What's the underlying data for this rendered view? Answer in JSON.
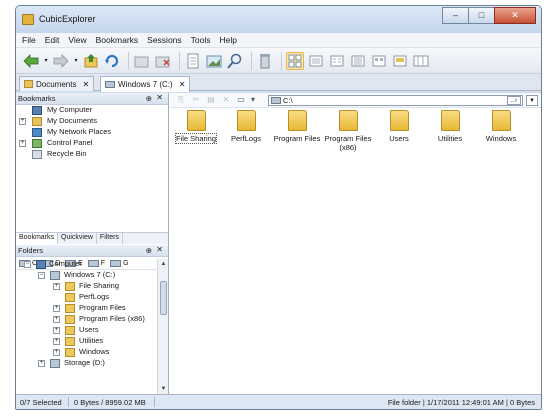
{
  "window": {
    "title": "CubicExplorer",
    "minimize": "–",
    "maximize": "□",
    "close": "✕"
  },
  "menu": [
    "File",
    "Edit",
    "View",
    "Bookmarks",
    "Sessions",
    "Tools",
    "Help"
  ],
  "toolbar_icons": [
    "back-arrow-icon",
    "forward-arrow-icon",
    "up-folder-icon",
    "refresh-icon",
    "new-folder-icon",
    "delete-folder-icon",
    "page-icon",
    "image-icon",
    "search-icon",
    "recycle-icon",
    "thumbnails-view-icon",
    "icons-view-icon",
    "list-view-icon",
    "details-view-icon",
    "tiles-view-icon",
    "filmstrip-view-icon",
    "grid-view-icon"
  ],
  "tabs": [
    {
      "label": "Documents",
      "close": "✕"
    },
    {
      "label": "Windows 7 (C:)",
      "close": "✕"
    }
  ],
  "bookmarks": {
    "title": "Bookmarks",
    "pin": "⊕",
    "close": "✕",
    "items": [
      {
        "label": "My Computer",
        "icon": "computer-icon",
        "expander": ""
      },
      {
        "label": "My Documents",
        "icon": "documents-icon",
        "expander": "+"
      },
      {
        "label": "My Network Places",
        "icon": "network-icon",
        "expander": ""
      },
      {
        "label": "Control Panel",
        "icon": "control-panel-icon",
        "expander": "+"
      },
      {
        "label": "Recycle Bin",
        "icon": "recycle-bin-icon",
        "expander": ""
      }
    ]
  },
  "subtabs": [
    "Bookmarks",
    "Quickview",
    "Filters"
  ],
  "folders": {
    "title": "Folders",
    "pin": "⊕",
    "close": "✕",
    "drives": [
      "C",
      "D",
      "E",
      "F",
      "G"
    ],
    "more": "»",
    "tree": [
      {
        "label": "Computer",
        "expander": "−",
        "icon": "computer-icon"
      },
      {
        "label": "Windows 7 (C:)",
        "expander": "−",
        "icon": "drive-icon"
      },
      {
        "label": "File Sharing",
        "expander": "+",
        "icon": "folder-icon"
      },
      {
        "label": "PerfLogs",
        "expander": "",
        "icon": "folder-icon"
      },
      {
        "label": "Program Files",
        "expander": "+",
        "icon": "folder-icon"
      },
      {
        "label": "Program Files (x86)",
        "expander": "+",
        "icon": "folder-icon"
      },
      {
        "label": "Users",
        "expander": "+",
        "icon": "folder-icon"
      },
      {
        "label": "Utilities",
        "expander": "+",
        "icon": "folder-icon"
      },
      {
        "label": "Windows",
        "expander": "+",
        "icon": "folder-icon"
      },
      {
        "label": "Storage (D:)",
        "expander": "+",
        "icon": "drive-icon"
      }
    ]
  },
  "address": {
    "value": "C:\\",
    "go": "..›"
  },
  "files": [
    {
      "label": "File Sharing",
      "selected": true
    },
    {
      "label": "PerfLogs",
      "selected": false
    },
    {
      "label": "Program Files",
      "selected": false
    },
    {
      "label": "Program Files (x86)",
      "selected": false
    },
    {
      "label": "Users",
      "selected": false
    },
    {
      "label": "Utilities",
      "selected": false
    },
    {
      "label": "Windows",
      "selected": false
    }
  ],
  "status": {
    "selected": "0/7 Selected",
    "size": "0 Bytes / 8959.02 MB",
    "info": "File folder | 1/17/2011 12:49:01 AM | 0 Bytes"
  }
}
